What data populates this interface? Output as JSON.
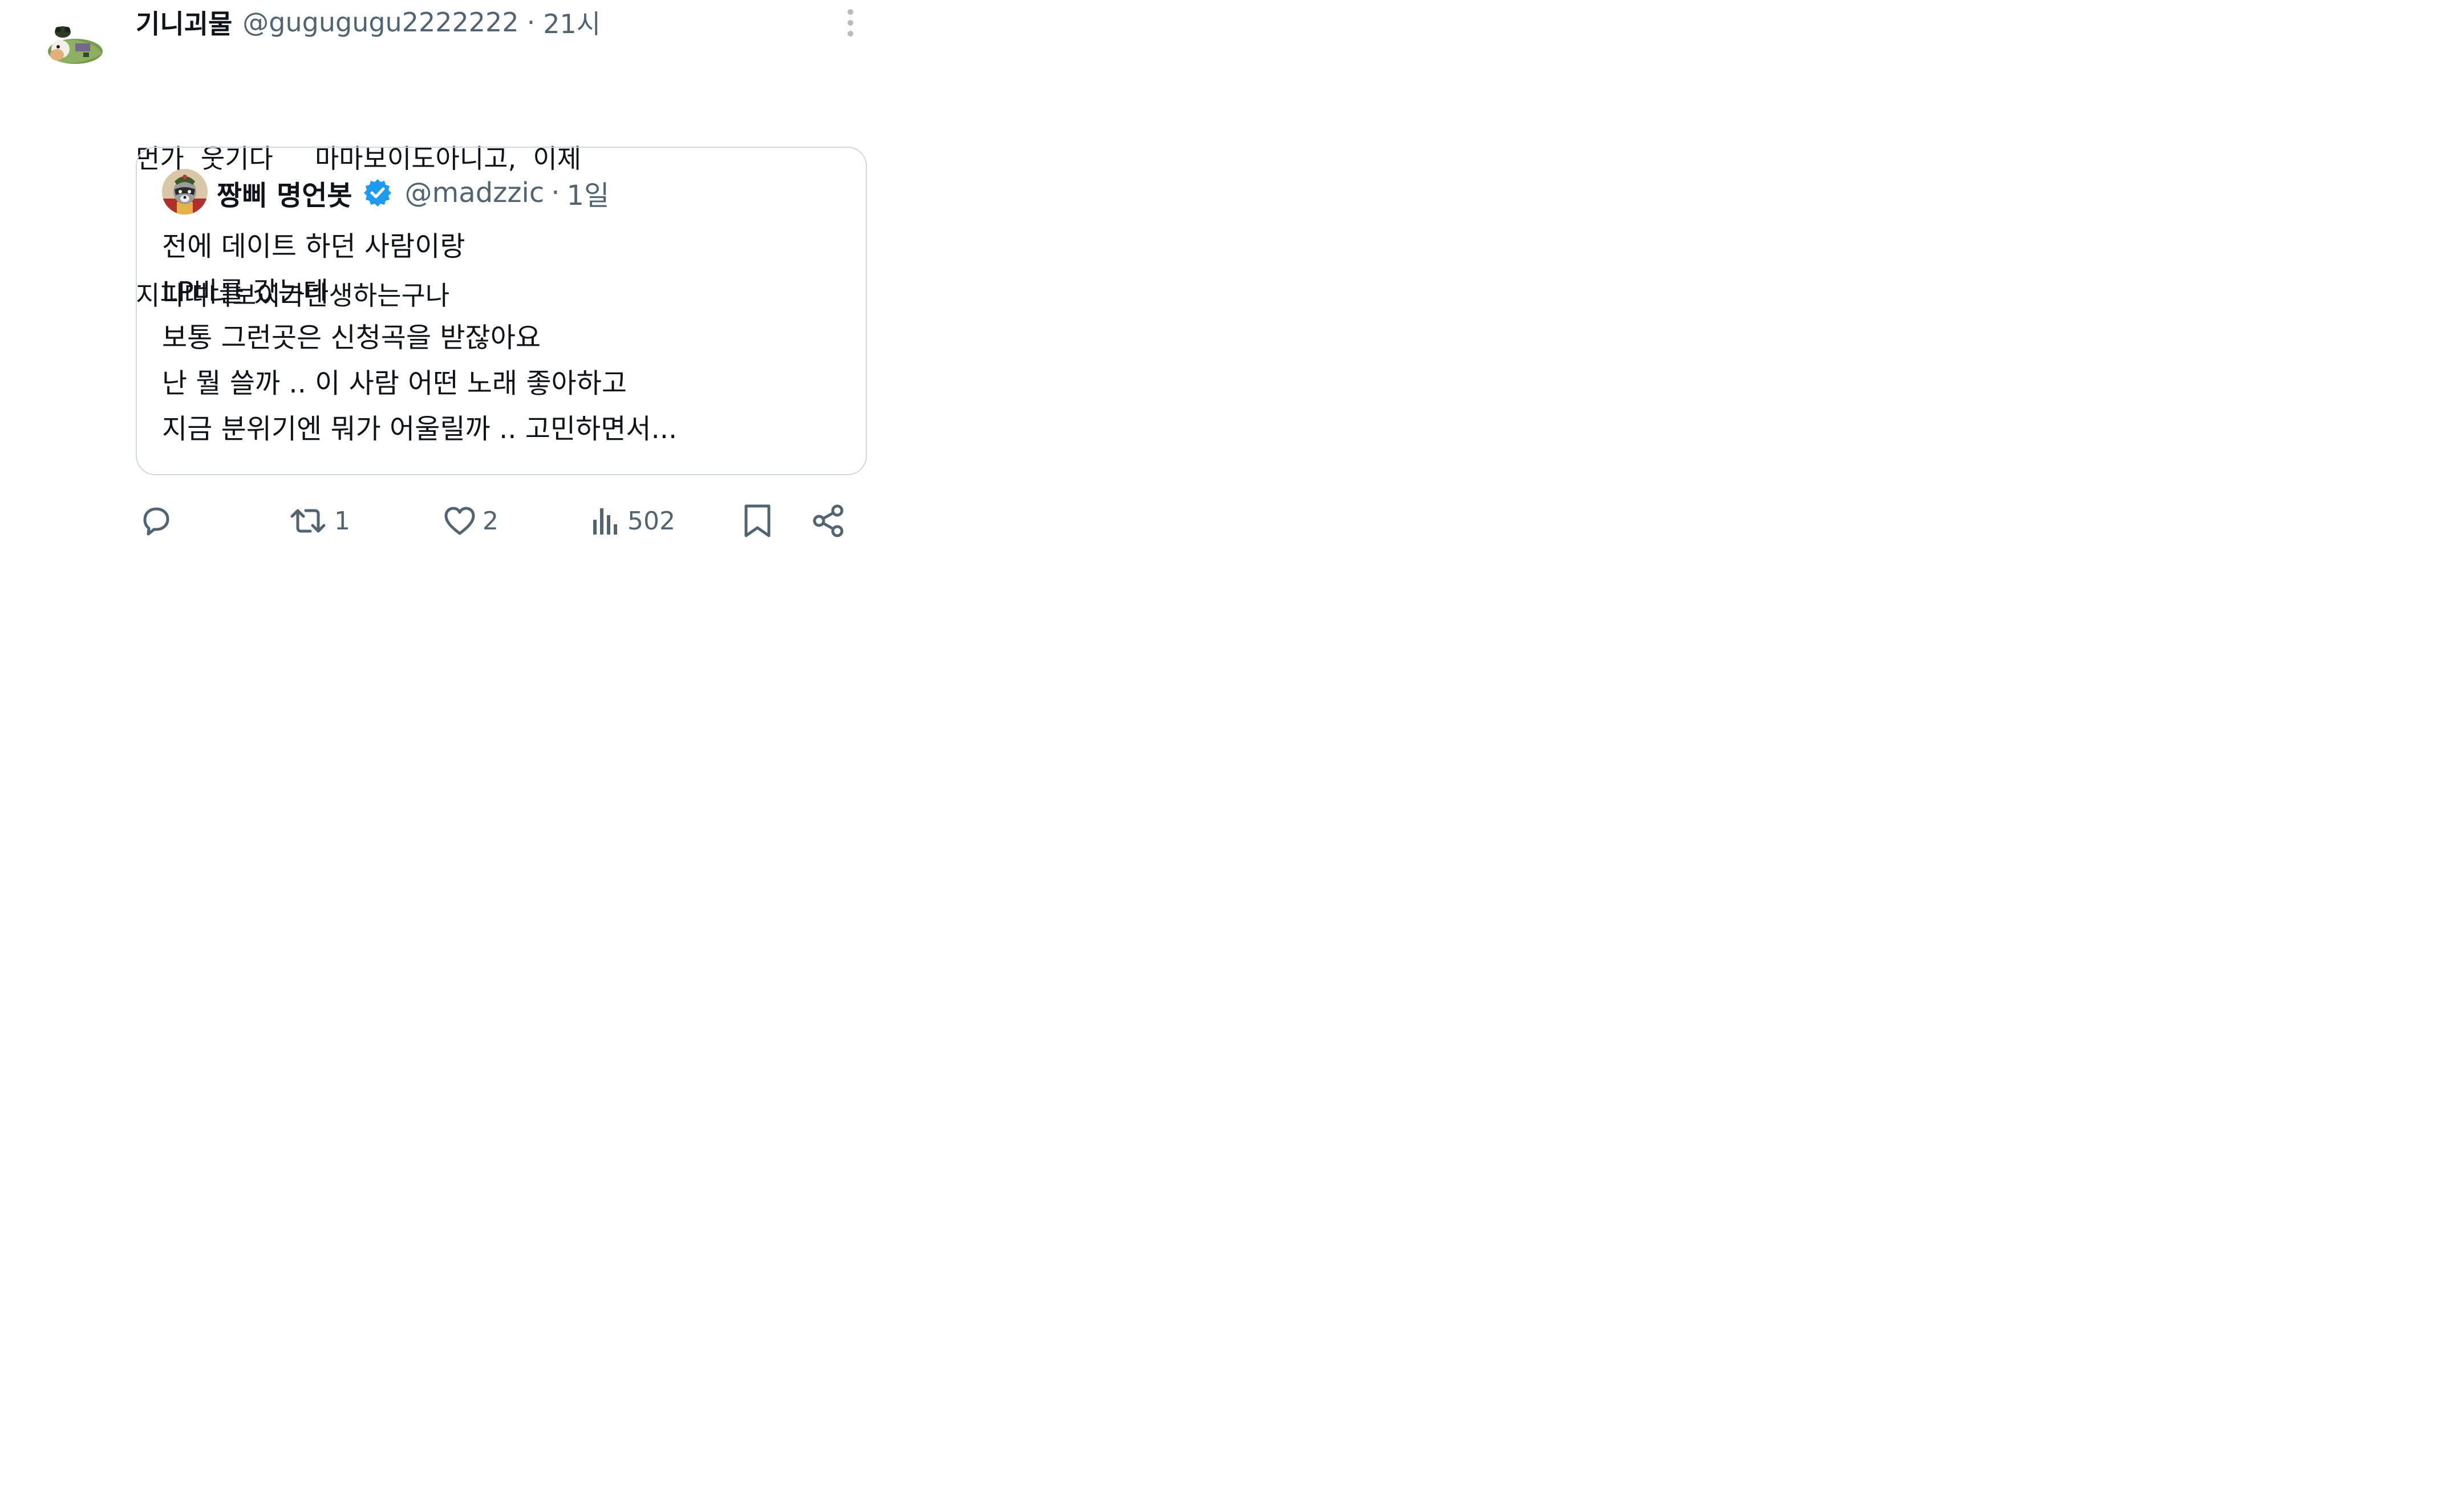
{
  "tweet": {
    "display_name": "기니괴물",
    "handle": "@gugugugu2222222",
    "separator": "·",
    "time": "21시",
    "text_lines": [
      "먼가  웃기다     마마보이도아니고,  이제",
      "지피띠니보이가탄생하는구나"
    ],
    "avatar_icon": "guinea-pig-frog-avatar",
    "more_icon": "more-vertical-icon"
  },
  "quote": {
    "display_name": "짱삐 명언봇",
    "handle": "@madzzic",
    "separator": "·",
    "time": "1일",
    "verified_icon": "verified-badge-icon",
    "avatar_icon": "raccoon-avatar",
    "text_lines": [
      "전에 데이트 하던 사람이랑",
      "LP바를 갔는데",
      "보통 그런곳은 신청곡을 받잖아요",
      "난 뭘 쓸까 .. 이 사람 어떤 노래 좋아하고",
      "지금 분위기엔 뭐가 어울릴까 .. 고민하면서..."
    ]
  },
  "actions": {
    "reply_count": "",
    "retweet_count": "1",
    "like_count": "2",
    "views_count": "502"
  },
  "colors": {
    "text": "#0f1419",
    "secondary": "#536471",
    "border": "#cfd9de",
    "verified": "#1d9bf0"
  }
}
